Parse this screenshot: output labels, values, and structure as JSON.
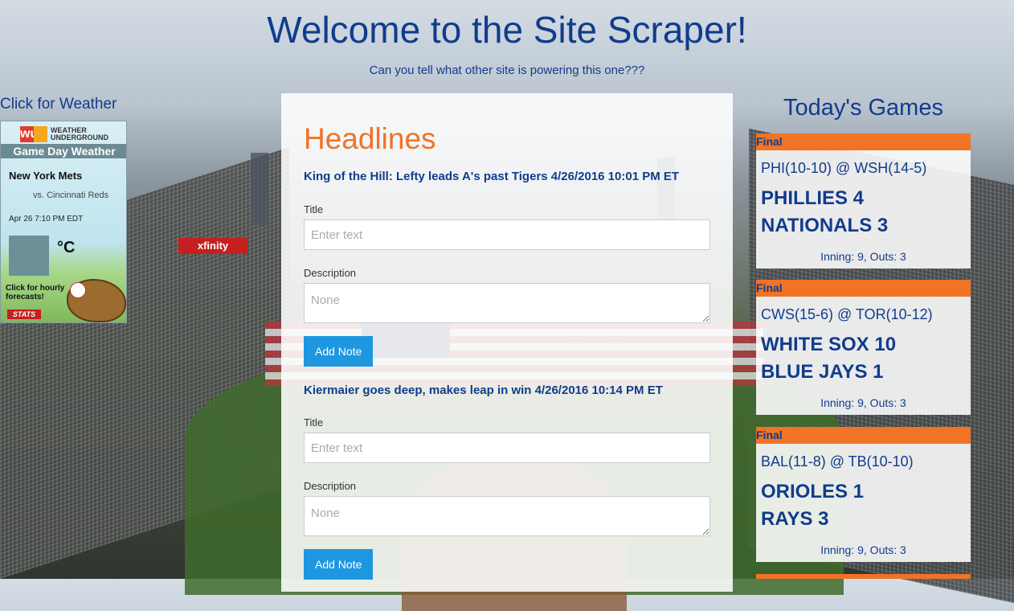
{
  "page": {
    "title": "Welcome to the Site Scraper!",
    "subtitle": "Can you tell what other site is powering this one???"
  },
  "weather": {
    "link_label": "Click for Weather",
    "brand_letters": "wu",
    "brand_line1": "WEATHER",
    "brand_line2": "UNDERGROUND",
    "banner": "Game Day Weather",
    "team": "New York Mets",
    "opponent": "vs. Cincinnati Reds",
    "datetime": "Apr 26 7:10 PM EDT",
    "temperature": "°C",
    "hourly_line1": "Click for hourly",
    "hourly_line2": "forecasts!",
    "sponsor": "STATS"
  },
  "headlines": {
    "heading": "Headlines",
    "title_label": "Title",
    "title_placeholder": "Enter text",
    "description_label": "Description",
    "description_placeholder": "None",
    "add_note_label": "Add Note",
    "articles": [
      {
        "headline": "King of the Hill: Lefty leads A's past Tigers 4/26/2016 10:01 PM ET"
      },
      {
        "headline": "Kiermaier goes deep, makes leap in win 4/26/2016 10:14 PM ET"
      }
    ]
  },
  "games": {
    "heading": "Today's Games",
    "items": [
      {
        "status": "Final",
        "matchup": "PHI(10-10) @ WSH(14-5)",
        "away": "PHILLIES 4",
        "home": "NATIONALS 3",
        "inning": "Inning: 9, Outs: 3"
      },
      {
        "status": "Final",
        "matchup": "CWS(15-6) @ TOR(10-12)",
        "away": "WHITE SOX 10",
        "home": "BLUE JAYS 1",
        "inning": "Inning: 9, Outs: 3"
      },
      {
        "status": "Final",
        "matchup": "BAL(11-8) @ TB(10-10)",
        "away": "ORIOLES 1",
        "home": "RAYS 3",
        "inning": "Inning: 9, Outs: 3"
      }
    ]
  },
  "background": {
    "scoreboard_sign": "xfinity"
  },
  "colors": {
    "brand_blue": "#113c8c",
    "accent_orange": "#f07326",
    "button_blue": "#1e97e0"
  }
}
